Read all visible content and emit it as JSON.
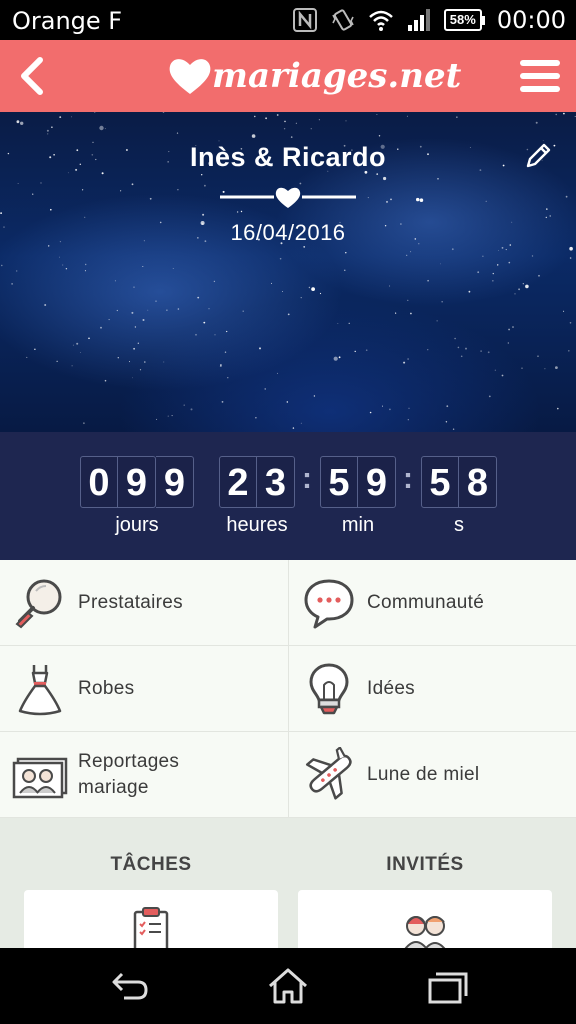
{
  "status_bar": {
    "carrier": "Orange F",
    "battery": "58%",
    "time": "00:00",
    "icons": [
      "nfc-icon",
      "vibrate-icon",
      "wifi-icon",
      "signal-icon",
      "battery-icon"
    ]
  },
  "header": {
    "logo_text": "mariages.net",
    "back_icon": "chevron-left-icon",
    "menu_icon": "hamburger-menu-icon",
    "color": "#f26d6d"
  },
  "hero": {
    "couple_names": "Inès & Ricardo",
    "wedding_date": "16/04/2016",
    "edit_icon": "pencil-icon"
  },
  "countdown": {
    "days": [
      "0",
      "9",
      "9"
    ],
    "hours": [
      "2",
      "3"
    ],
    "minutes": [
      "5",
      "9"
    ],
    "seconds": [
      "5",
      "8"
    ],
    "days_label": "jours",
    "hours_label": "heures",
    "minutes_label": "min",
    "seconds_label": "s",
    "background": "#1e2650"
  },
  "menu": {
    "items": [
      {
        "label": "Prestataires",
        "icon": "magnifier-icon"
      },
      {
        "label": "Communauté",
        "icon": "speech-bubble-icon"
      },
      {
        "label": "Robes",
        "icon": "dress-icon"
      },
      {
        "label": "Idées",
        "icon": "lightbulb-icon"
      },
      {
        "label": "Reportages\nmariage",
        "icon": "photos-icon"
      },
      {
        "label": "Lune de miel",
        "icon": "airplane-icon"
      }
    ]
  },
  "sections": {
    "tasks_title": "TÂCHES",
    "guests_title": "INVITÉS",
    "tasks_icon": "clipboard-icon",
    "guests_icon": "couple-icon"
  },
  "nav": {
    "back": "back-icon",
    "home": "home-icon",
    "recents": "recents-icon"
  }
}
